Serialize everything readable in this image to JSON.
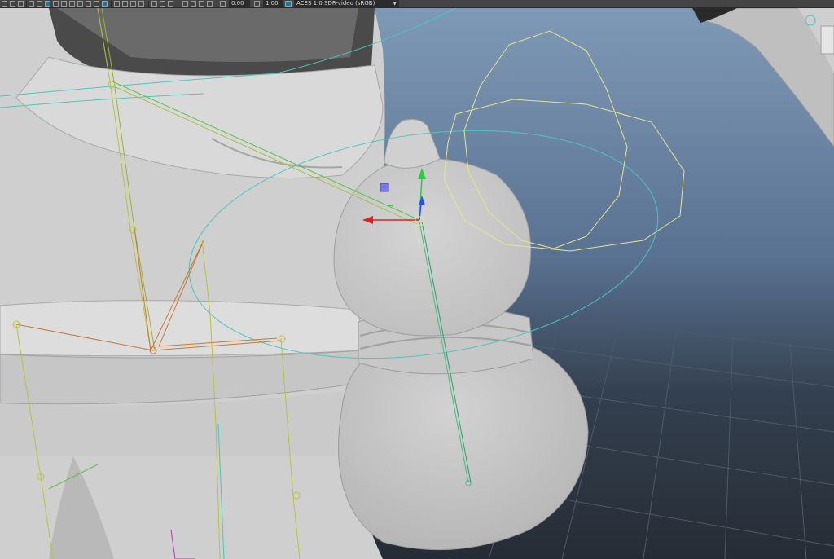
{
  "toolbar": {
    "exposure_value": "0.00",
    "gamma_value": "1.00",
    "color_space": "ACES 1.0 SDR-video (sRGB)",
    "icons": [
      "grid-icon",
      "camera-icon",
      "wireframe-icon",
      "smooth-shade-icon",
      "textured-icon",
      "lights-icon",
      "shadows-icon",
      "ambient-occlusion-icon",
      "motion-blur-icon",
      "anti-alias-icon",
      "isolate-icon",
      "xray-icon",
      "xray-joints-icon",
      "resolution-gate-icon",
      "gate-mask-icon",
      "field-chart-icon",
      "safe-action-icon",
      "exposure-icon",
      "gamma-icon",
      "color-management-icon"
    ]
  },
  "viewport": {
    "colors": {
      "sky_top": "#7c97b5",
      "sky_bottom": "#2f3946",
      "model": "#c9c9c9",
      "joint_yellow": "#b9c43a",
      "joint_orange": "#c27a35",
      "ik_green": "#3fc07a",
      "curve_cyan": "#49c6c0",
      "curve_yellow": "#e8e48a",
      "axis_x": "#e02020",
      "axis_y": "#22d040",
      "axis_z": "#2050ff"
    }
  }
}
